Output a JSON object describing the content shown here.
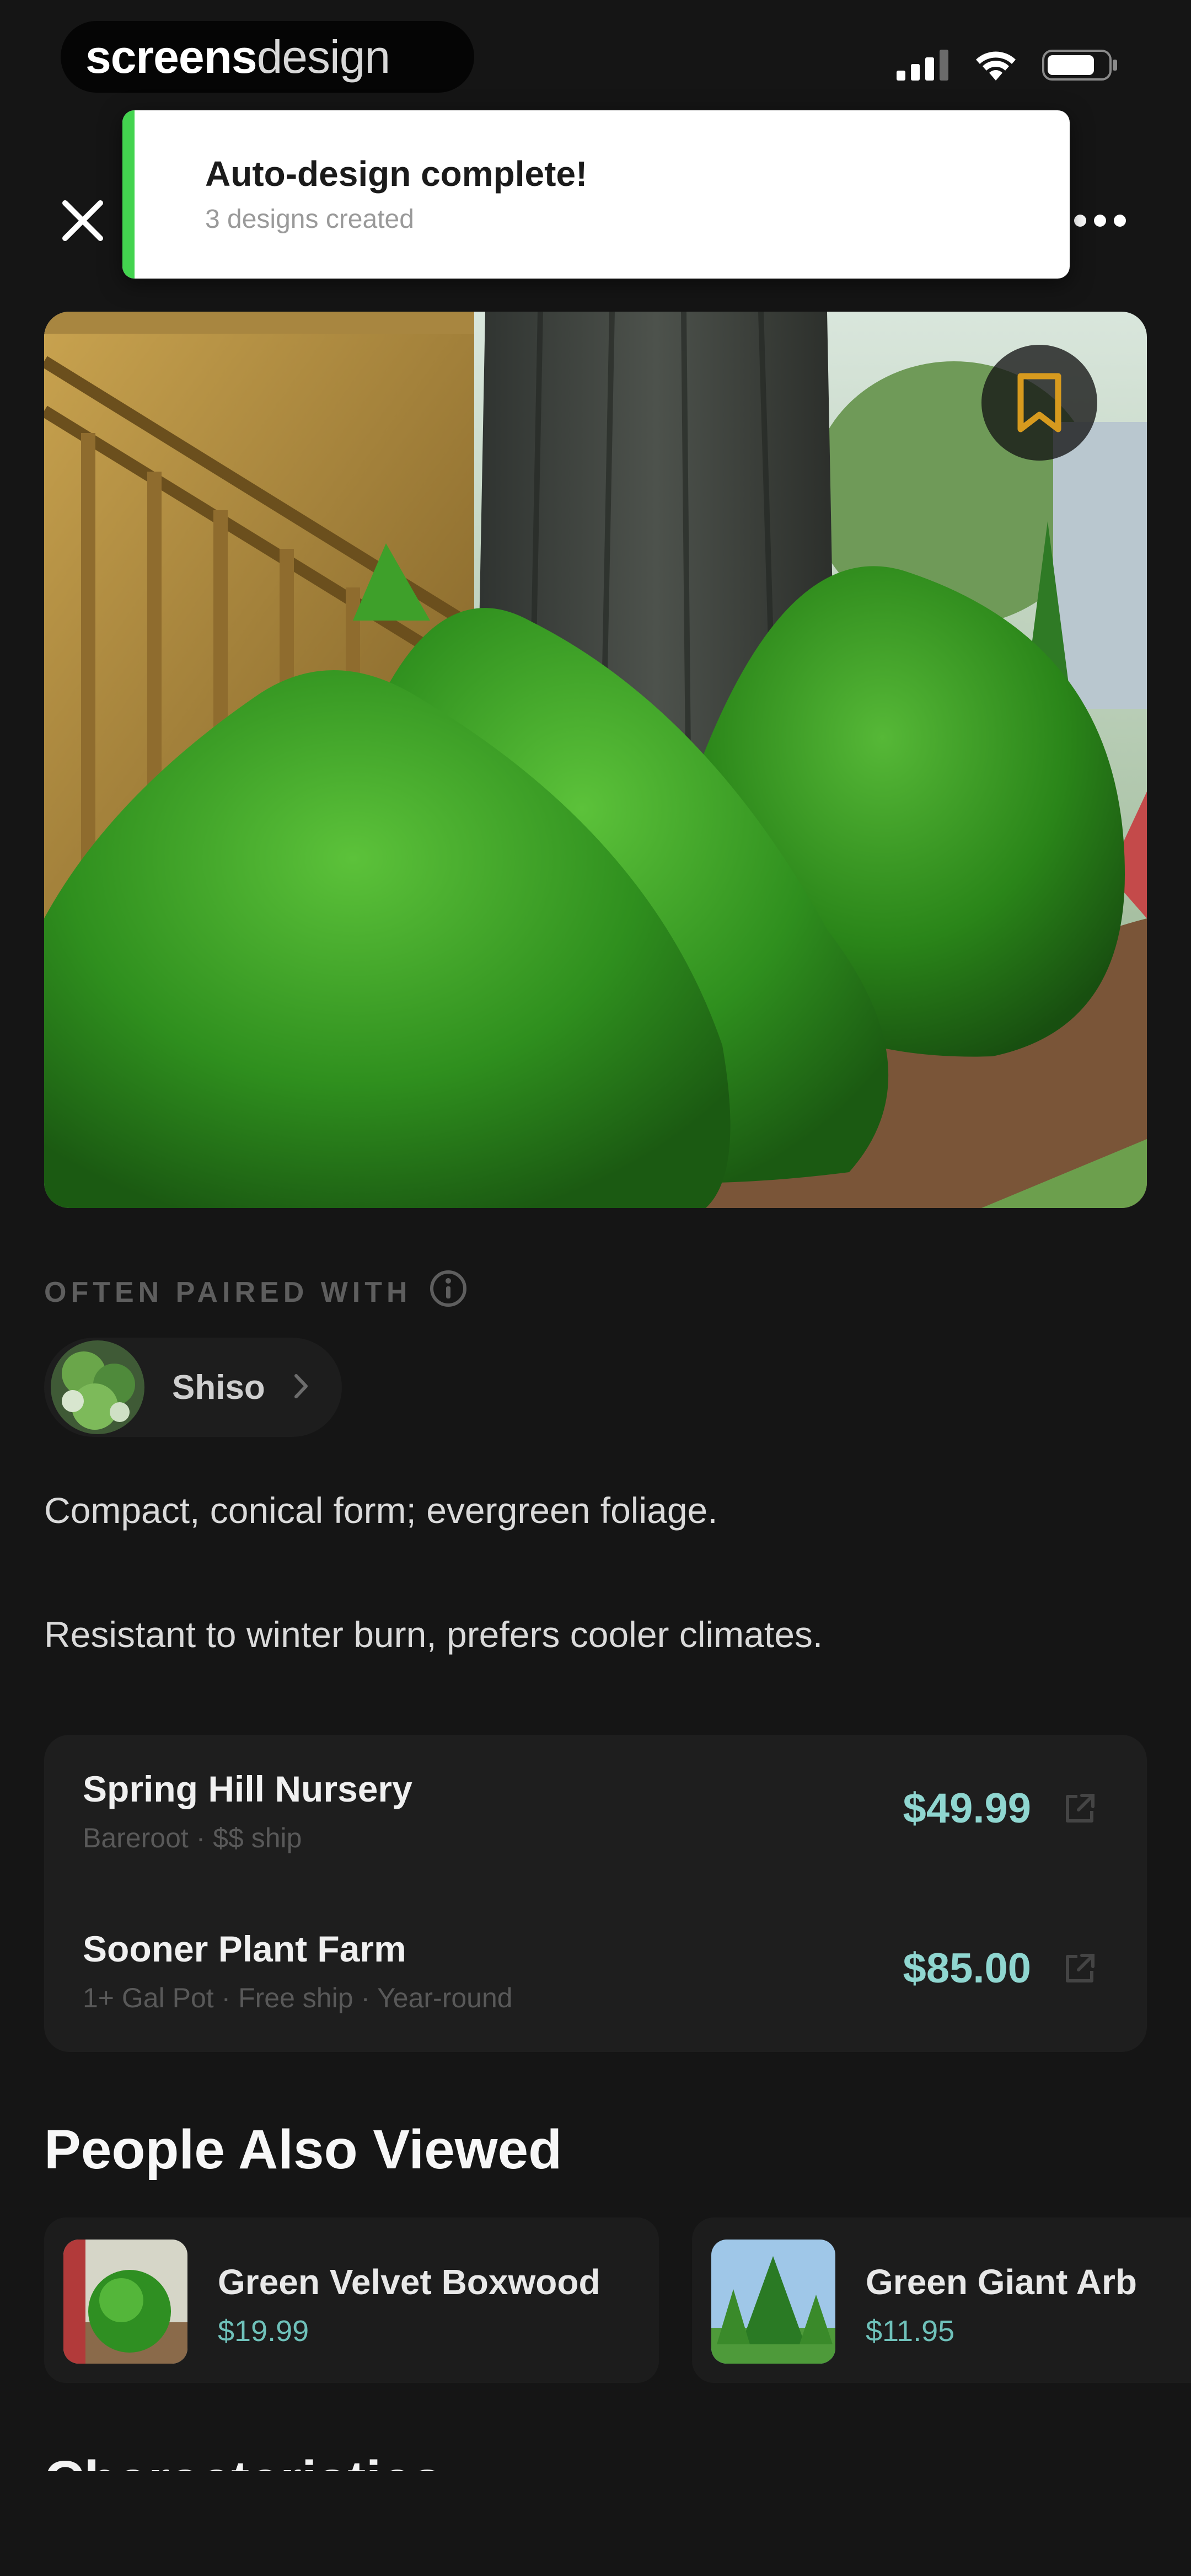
{
  "status_bar": {
    "brand_bold": "screens",
    "brand_light": "design",
    "icons": [
      "cellular-signal-icon",
      "wifi-icon",
      "battery-icon"
    ]
  },
  "nav": {
    "close_icon": "close-icon",
    "more_icon": "more-horizontal-icon"
  },
  "toast": {
    "title": "Auto-design complete!",
    "subtitle": "3 designs created",
    "accent_color": "#43d44f"
  },
  "hero": {
    "bookmark_icon": "bookmark-icon",
    "bookmark_color": "#d79a1e"
  },
  "often_paired": {
    "heading": "OFTEN PAIRED WITH",
    "info_icon": "info-icon",
    "chip_label": "Shiso"
  },
  "description": {
    "line1": "Compact, conical form; evergreen foliage.",
    "line2": "Resistant to winter burn, prefers cooler climates."
  },
  "sellers": [
    {
      "name": "Spring Hill Nursery",
      "meta": "Bareroot · $$ ship",
      "price": "$49.99"
    },
    {
      "name": "Sooner Plant Farm",
      "meta": "1+ Gal Pot · Free ship · Year-round",
      "price": "$85.00"
    }
  ],
  "people_also_viewed": {
    "title": "People Also Viewed",
    "items": [
      {
        "name": "Green Velvet Boxwood",
        "price": "$19.99"
      },
      {
        "name": "Green Giant Arb",
        "price": "$11.95"
      }
    ]
  },
  "characteristics": {
    "title": "Characteristics"
  },
  "colors": {
    "background": "#151515",
    "card": "#1e1e1e",
    "price": "#8fd6d0"
  }
}
